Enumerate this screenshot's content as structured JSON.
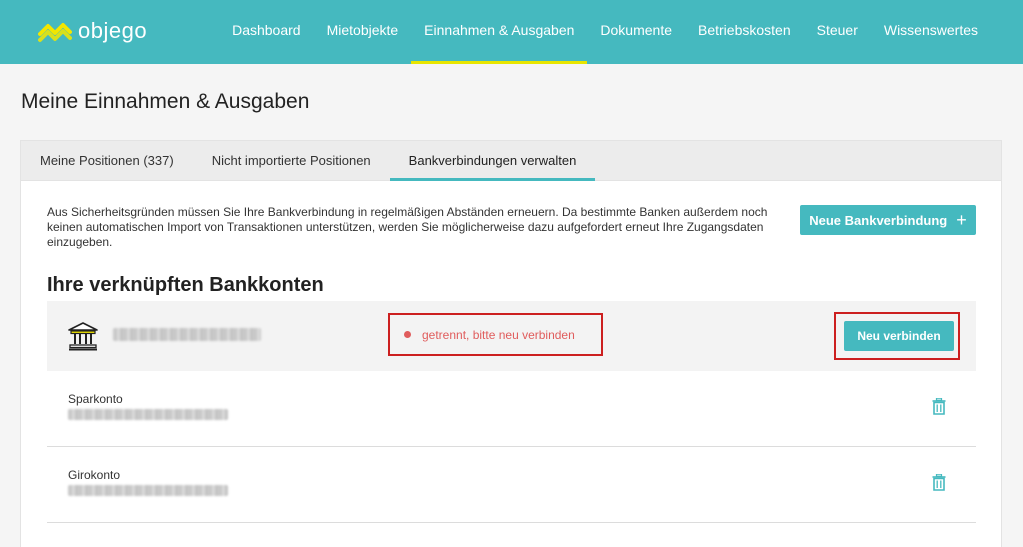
{
  "app": {
    "logo_text": "objego",
    "colors": {
      "primary": "#45b9bf",
      "accent_underline": "#e8e500",
      "logo_mark": "#f2e600",
      "error": "#e05c5c"
    }
  },
  "nav": {
    "items": [
      {
        "label": "Dashboard"
      },
      {
        "label": "Mietobjekte"
      },
      {
        "label": "Einnahmen & Ausgaben"
      },
      {
        "label": "Dokumente"
      },
      {
        "label": "Betriebskosten"
      },
      {
        "label": "Steuer"
      },
      {
        "label": "Wissenswertes"
      }
    ],
    "active": "Einnahmen & Ausgaben"
  },
  "page": {
    "title": "Meine Einnahmen & Ausgaben"
  },
  "tabs": {
    "items": [
      {
        "label": "Meine Positionen (337)"
      },
      {
        "label": "Nicht importierte Positionen"
      },
      {
        "label": "Bankverbindungen verwalten"
      }
    ],
    "active": "Bankverbindungen verwalten"
  },
  "bank_connections": {
    "info_text": "Aus Sicherheitsgründen müssen Sie Ihre Bankverbindung in regelmäßigen Abständen erneuern. Da bestimmte Banken außerdem noch keinen automatischen Import von Transaktionen unterstützen, werden Sie möglicherweise dazu aufgefordert erneut Ihre Zugangsdaten einzugeben.",
    "new_button_label": "Neue Bankverbindung",
    "new_button_icon": "plus-icon",
    "section_title": "Ihre verknüpften Bankkonten",
    "bank": {
      "icon": "bank-building-icon",
      "status_text": "getrennt, bitte neu verbinden",
      "reconnect_label": "Neu verbinden"
    },
    "accounts": [
      {
        "name": "Sparkonto",
        "delete_icon": "trash-icon"
      },
      {
        "name": "Girokonto",
        "delete_icon": "trash-icon"
      }
    ]
  }
}
